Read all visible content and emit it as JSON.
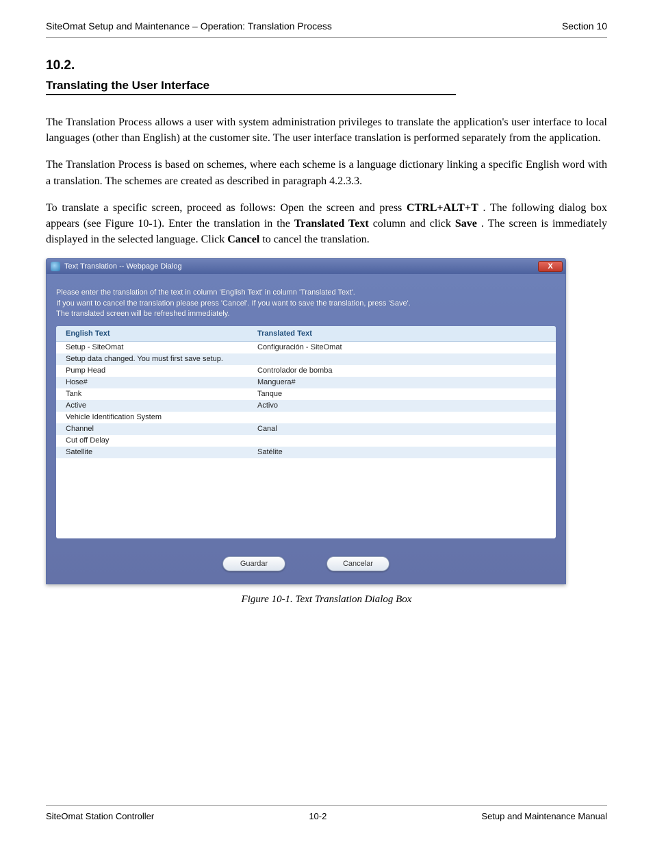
{
  "header": {
    "left": "SiteOmat Setup and Maintenance – Operation: Translation Process",
    "right": "Section 10"
  },
  "section": {
    "num": "10.2.",
    "title": "Translating the User Interface"
  },
  "paragraphs": {
    "p1": "The Translation Process allows a user with system administration privileges to translate the application's user interface to local languages (other than English) at the customer site. The user interface translation is performed separately from the application.",
    "p2": "The Translation Process is based on schemes, where each scheme is a language dictionary linking a specific English word with a translation. The schemes are created as described in paragraph 4.2.3.3.",
    "p3_a": "To translate a specific screen, proceed as follows: Open the screen and press ",
    "p3_shortcut": "CTRL+ALT+T",
    "p3_b": ". The following dialog box appears (see Figure 10-1). Enter the translation in the ",
    "p3_field": "Translated Text",
    "p3_c": " column and click ",
    "p3_save": "Save",
    "p3_d": ". The screen is immediately displayed in the selected language. Click ",
    "p3_cancel": "Cancel",
    "p3_e": " to cancel the translation."
  },
  "dialog": {
    "title": "Text Translation -- Webpage Dialog",
    "close": "X",
    "instructions_l1": "Please enter the translation of the text in column 'English Text' in column 'Translated Text'.",
    "instructions_l2": "If you want to cancel the translation please press 'Cancel'. If you want to save the translation, press 'Save'.",
    "instructions_l3": "The translated screen will be refreshed immediately.",
    "columns": {
      "english": "English Text",
      "translated": "Translated Text"
    },
    "rows": [
      {
        "en": "Setup - SiteOmat",
        "tr": "Configuración - SiteOmat"
      },
      {
        "en": "Setup data changed. You must first save setup.",
        "tr": ""
      },
      {
        "en": "Pump Head",
        "tr": "Controlador de bomba"
      },
      {
        "en": "Hose#",
        "tr": "Manguera#"
      },
      {
        "en": "Tank",
        "tr": "Tanque"
      },
      {
        "en": "Active",
        "tr": "Activo"
      },
      {
        "en": "Vehicle Identification System",
        "tr": ""
      },
      {
        "en": "Channel",
        "tr": "Canal"
      },
      {
        "en": "Cut off Delay",
        "tr": ""
      },
      {
        "en": "Satellite",
        "tr": "Satélite"
      }
    ],
    "buttons": {
      "save": "Guardar",
      "cancel": "Cancelar"
    }
  },
  "figure_caption": "Figure 10-1. Text Translation Dialog Box",
  "footer": {
    "left": "SiteOmat Station Controller",
    "center": "10-2",
    "right": "Setup and Maintenance Manual"
  }
}
